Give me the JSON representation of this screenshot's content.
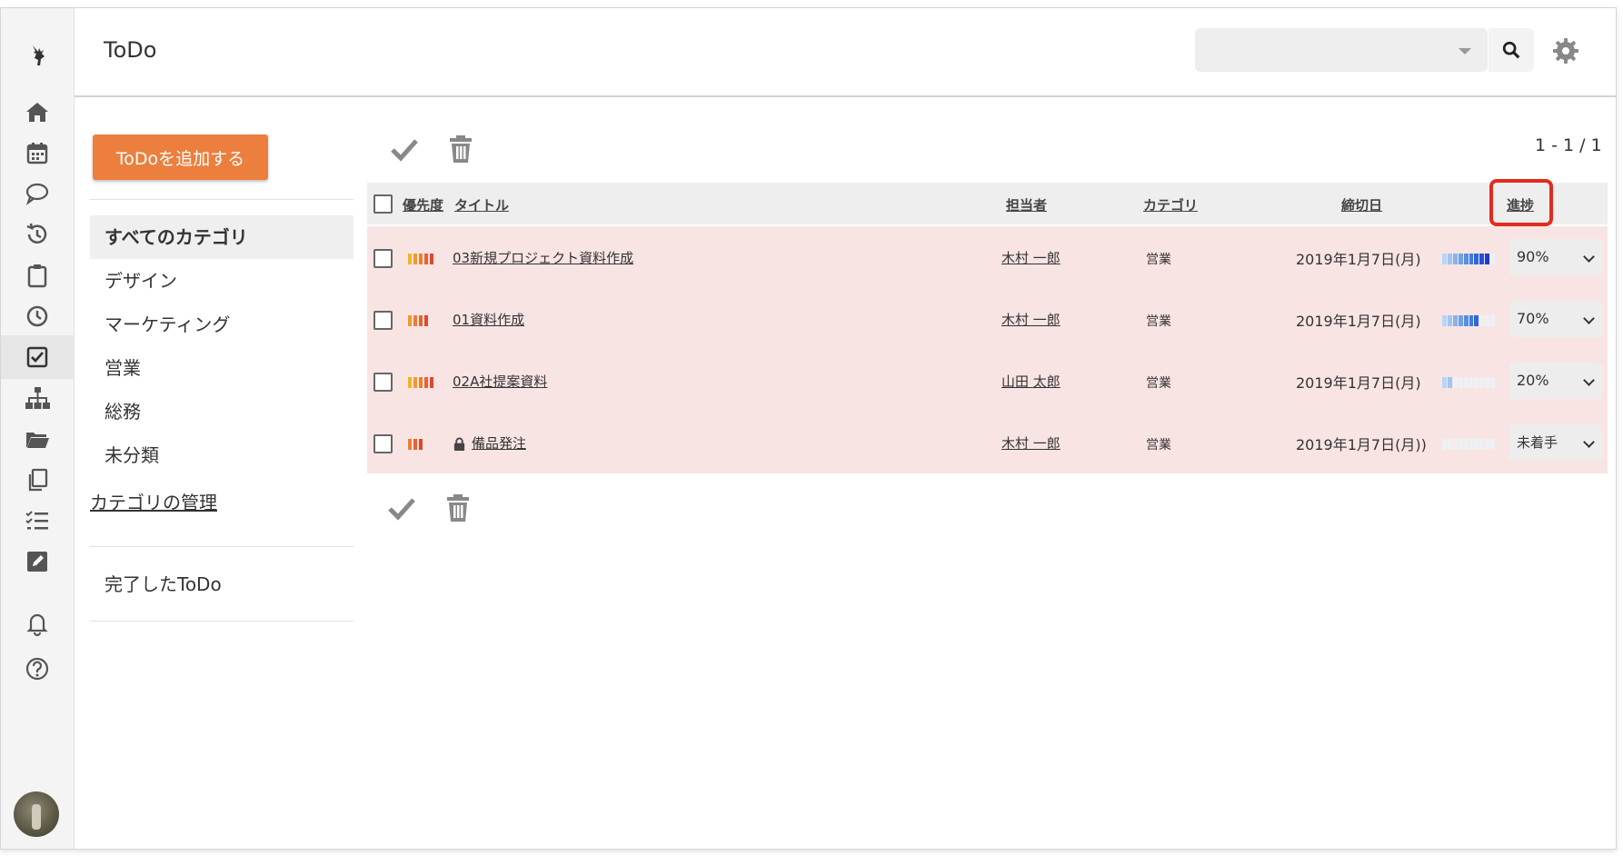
{
  "app": {
    "title": "ToDo"
  },
  "header": {
    "search_value": ""
  },
  "categories": {
    "add_button": "ToDoを追加する",
    "items": [
      "すべてのカテゴリ",
      "デザイン",
      "マーケティング",
      "営業",
      "総務",
      "未分類"
    ],
    "manage_link": "カテゴリの管理",
    "completed_link": "完了したToDo"
  },
  "pagination": "1 - 1 / 1",
  "table": {
    "headers": {
      "priority": "優先度",
      "title": "タイトル",
      "assignee": "担当者",
      "category": "カテゴリ",
      "due": "締切日",
      "progress": "進捗"
    },
    "rows": [
      {
        "priority": 5,
        "title": "03新規プロジェクト資料作成",
        "assignee": "木村 一郎",
        "category": "営業",
        "due": "2019年1月7日(月)",
        "progress": 0.9,
        "progress_label": "90%",
        "locked": false
      },
      {
        "priority": 4,
        "title": "01資料作成",
        "assignee": "木村 一郎",
        "category": "営業",
        "due": "2019年1月7日(月)",
        "progress": 0.7,
        "progress_label": "70%",
        "locked": false
      },
      {
        "priority": 5,
        "title": "02A社提案資料",
        "assignee": "山田 太郎",
        "category": "営業",
        "due": "2019年1月7日(月)",
        "progress": 0.2,
        "progress_label": "20%",
        "locked": false
      },
      {
        "priority": 3,
        "title": "備品発注",
        "assignee": "木村 一郎",
        "category": "営業",
        "due": "2019年1月7日(月))",
        "progress": 0,
        "progress_label": "未着手",
        "locked": true
      }
    ]
  },
  "colors": {
    "accent_orange": "#ec7f3e",
    "row_highlight": "#f9e4e4",
    "annotation_red": "#e22b1c",
    "progress_blue": "#2f4bff"
  }
}
